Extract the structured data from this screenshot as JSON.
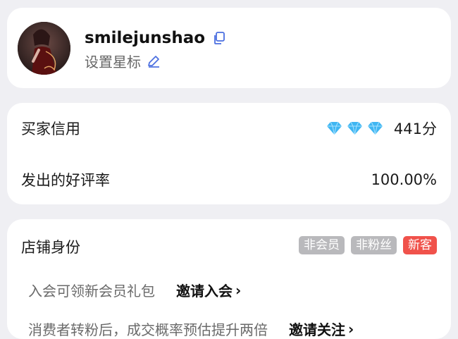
{
  "profile": {
    "username": "smilejunshao",
    "star_label": "设置星标"
  },
  "stats": {
    "credit_label": "买家信用",
    "credit_score": "441分",
    "diamond_count": 3,
    "diamond_color": "#3fb6f2",
    "rating_label": "发出的好评率",
    "rating_value": "100.00%"
  },
  "store": {
    "title": "店铺身份",
    "badges": [
      "非会员",
      "非粉丝",
      "新客"
    ],
    "invite_desc": "入会可领新会员礼包",
    "invite_action": "邀请入会",
    "follow_desc": "消费者转粉后，成交概率预估提升两倍",
    "follow_action": "邀请关注"
  }
}
